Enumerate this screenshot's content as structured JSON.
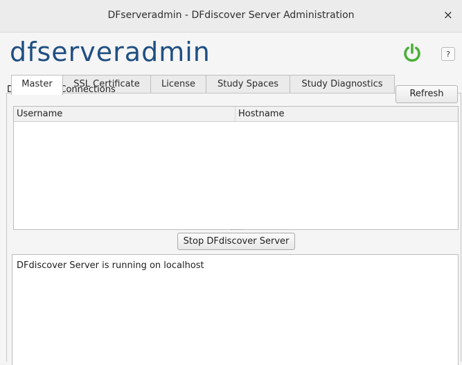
{
  "window": {
    "title": "DFserveradmin - DFdiscover Server Administration",
    "close_glyph": "×"
  },
  "app": {
    "logo_text": "dfserveradmin",
    "help_label": "?",
    "power_color": "#4caf3a",
    "logo_color": "#1f4f82"
  },
  "tabs": [
    {
      "label": "Master",
      "active": true
    },
    {
      "label": "SSL Certificate",
      "active": false
    },
    {
      "label": "License",
      "active": false
    },
    {
      "label": "Study Spaces",
      "active": false
    },
    {
      "label": "Study Diagnostics",
      "active": false
    }
  ],
  "connections": {
    "label": "DFdiscover Connections",
    "refresh_label": "Refresh",
    "columns": [
      "Username",
      "Hostname"
    ],
    "rows": []
  },
  "server": {
    "stop_label": "Stop DFdiscover Server",
    "status_text": "DFdiscover Server is running on localhost"
  }
}
